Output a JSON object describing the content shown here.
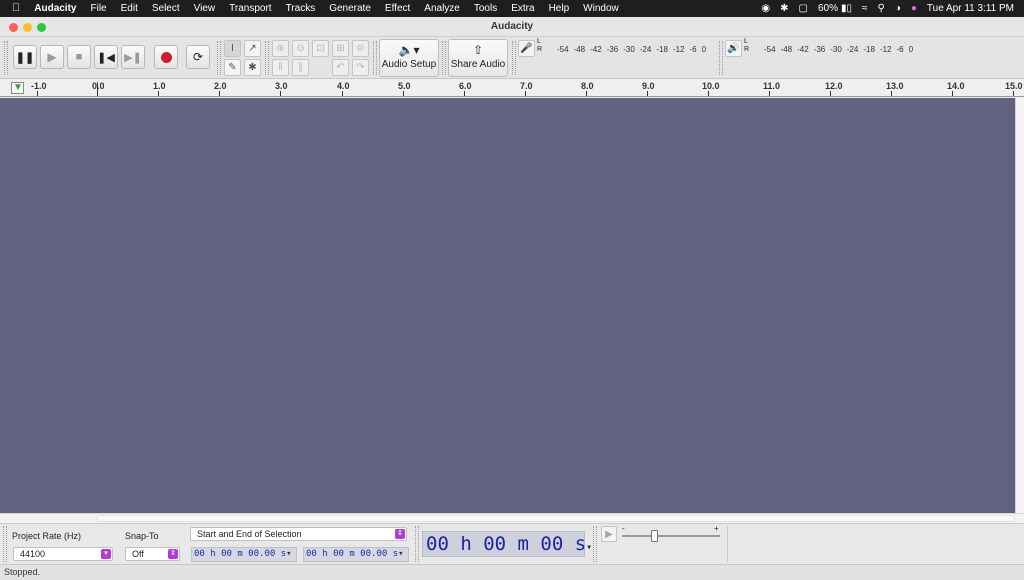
{
  "menubar": {
    "apple_icon": "apple-icon",
    "app_name": "Audacity",
    "items": [
      "File",
      "Edit",
      "Select",
      "View",
      "Transport",
      "Tracks",
      "Generate",
      "Effect",
      "Analyze",
      "Tools",
      "Extra",
      "Help",
      "Window"
    ],
    "battery": "60%",
    "datetime": "Tue Apr 11  3:11 PM"
  },
  "window": {
    "title": "Audacity"
  },
  "toolbar": {
    "audio_setup_label": "Audio Setup",
    "share_audio_label": "Share Audio",
    "record_meter": {
      "channels": [
        "L",
        "R"
      ],
      "scale": [
        "-54",
        "-48",
        "-42",
        "-36",
        "-30",
        "-24",
        "-18",
        "-12",
        "-6",
        "0"
      ]
    },
    "playback_meter": {
      "channels": [
        "L",
        "R"
      ],
      "scale": [
        "-54",
        "-48",
        "-42",
        "-36",
        "-30",
        "-24",
        "-18",
        "-12",
        "-6",
        "0"
      ]
    }
  },
  "ruler": {
    "ticks": [
      "-1.0",
      "0.0",
      "1.0",
      "2.0",
      "3.0",
      "4.0",
      "5.0",
      "6.0",
      "7.0",
      "8.0",
      "9.0",
      "10.0",
      "11.0",
      "12.0",
      "13.0",
      "14.0",
      "15.0"
    ]
  },
  "selection_toolbar": {
    "project_rate_label": "Project Rate (Hz)",
    "project_rate_value": "44100",
    "snap_to_label": "Snap-To",
    "snap_to_value": "Off",
    "selection_mode": "Start and End of Selection",
    "start_time": "00 h 00 m 00.00 s",
    "end_time": "00 h 00 m 00.00 s",
    "audio_position": "00 h 00 m 00 s",
    "play_at_speed": {
      "minus": "-",
      "plus": "+"
    }
  },
  "status": {
    "text": "Stopped."
  },
  "colors": {
    "track_background": "#60627f",
    "record_red": "#c8202a",
    "time_text": "#1d2fa6",
    "dropdown_accent": "#b23cd6"
  }
}
